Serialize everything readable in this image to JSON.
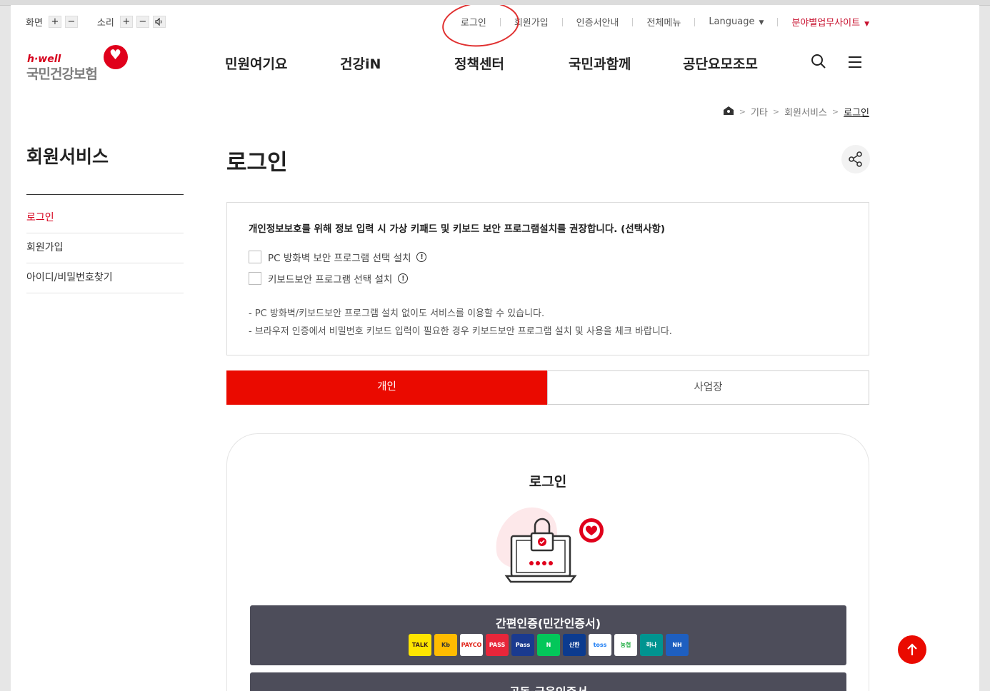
{
  "util": {
    "screen_label": "화면",
    "sound_label": "소리",
    "plus": "+",
    "minus": "−"
  },
  "topnav": {
    "login": "로그인",
    "join": "회원가입",
    "cert": "인증서안내",
    "allmenu": "전체메뉴",
    "language": "Language",
    "sites": "분야별업무사이트"
  },
  "logo": {
    "hwell": "h·well",
    "name": "국민건강보험"
  },
  "gnb": [
    "민원여기요",
    "건강iN",
    "정책센터",
    "국민과함께",
    "공단요모조모"
  ],
  "breadcrumb": [
    "기타",
    "회원서비스",
    "로그인"
  ],
  "side": {
    "title": "회원서비스",
    "items": [
      "로그인",
      "회원가입",
      "아이디/비밀번호찾기"
    ]
  },
  "main": {
    "title": "로그인",
    "notice_head": "개인정보보호를 위해 정보 입력 시 가상 키패드 및 키보드 보안 프로그램설치를 권장합니다. (선택사항)",
    "check1": "PC 방화벽 보안 프로그램 선택 설치",
    "check2": "키보드보안 프로그램 선택 설치",
    "note1": "- PC 방화벽/키보드보안 프로그램 설치 없이도 서비스를 이용할 수 있습니다.",
    "note2": "- 브라우저 인증에서 비밀번호 키보드 입력이 필요한 경우 키보드보안 프로그램 설치 및 사용을 체크 바랍니다.",
    "tabs": [
      "개인",
      "사업장"
    ],
    "login_title": "로그인",
    "easy_cert": "간편인증(민간인증서)",
    "common_cert": "공동·금융인증서"
  },
  "banks": [
    {
      "label": "TALK",
      "bg": "#fee500",
      "fg": "#3a1d1d"
    },
    {
      "label": "Kb",
      "bg": "#ffbc00",
      "fg": "#333"
    },
    {
      "label": "PAYCO",
      "bg": "#ffffff",
      "fg": "#e1261c"
    },
    {
      "label": "PASS",
      "bg": "#e8263a",
      "fg": "#ffffff"
    },
    {
      "label": "Pass",
      "bg": "#1a3a8f",
      "fg": "#ffffff"
    },
    {
      "label": "N",
      "bg": "#03c75a",
      "fg": "#ffffff"
    },
    {
      "label": "신한",
      "bg": "#0b3b8f",
      "fg": "#ffffff"
    },
    {
      "label": "toss",
      "bg": "#ffffff",
      "fg": "#1a7cf5"
    },
    {
      "label": "농협",
      "bg": "#ffffff",
      "fg": "#2bb24c"
    },
    {
      "label": "하나",
      "bg": "#009490",
      "fg": "#ffffff"
    },
    {
      "label": "NH",
      "bg": "#1e5fc0",
      "fg": "#ffffff"
    }
  ],
  "colors": {
    "brand_red": "#ea0a00",
    "dark_button": "#4d4d5a"
  }
}
